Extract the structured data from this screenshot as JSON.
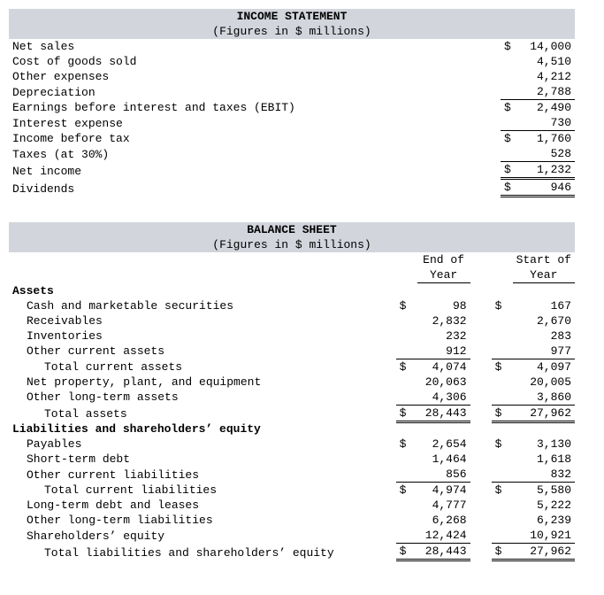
{
  "income": {
    "title": "INCOME STATEMENT",
    "subtitle": "(Figures in $ millions)",
    "rows": [
      {
        "label": "Net sales",
        "cur": "$",
        "val": "14,000",
        "indent": 0,
        "top": false,
        "dbl": false
      },
      {
        "label": "Cost of goods sold",
        "cur": "",
        "val": "4,510",
        "indent": 0,
        "top": false,
        "dbl": false
      },
      {
        "label": "Other expenses",
        "cur": "",
        "val": "4,212",
        "indent": 0,
        "top": false,
        "dbl": false
      },
      {
        "label": "Depreciation",
        "cur": "",
        "val": "2,788",
        "indent": 0,
        "top": false,
        "dbl": false
      },
      {
        "label": "Earnings before interest and taxes (EBIT)",
        "cur": "$",
        "val": "2,490",
        "indent": 0,
        "top": true,
        "dbl": false
      },
      {
        "label": "Interest expense",
        "cur": "",
        "val": "730",
        "indent": 0,
        "top": false,
        "dbl": false
      },
      {
        "label": "Income before tax",
        "cur": "$",
        "val": "1,760",
        "indent": 0,
        "top": true,
        "dbl": false
      },
      {
        "label": "Taxes (at 30%)",
        "cur": "",
        "val": "528",
        "indent": 0,
        "top": false,
        "dbl": false
      },
      {
        "label": "Net income",
        "cur": "$",
        "val": "1,232",
        "indent": 0,
        "top": true,
        "dbl": true
      },
      {
        "label": "Dividends",
        "cur": "$",
        "val": "946",
        "indent": 0,
        "top": false,
        "dbl": true
      }
    ]
  },
  "balance": {
    "title": "BALANCE SHEET",
    "subtitle": "(Figures in $ millions)",
    "col1_a": "End of",
    "col1_b": "Year",
    "col2_a": "Start of",
    "col2_b": "Year",
    "rows": [
      {
        "label": "Assets",
        "bold": true,
        "indent": 0,
        "cur1": "",
        "val1": "",
        "cur2": "",
        "val2": "",
        "top": false,
        "dbl": false
      },
      {
        "label": "Cash and marketable securities",
        "indent": 1,
        "cur1": "$",
        "val1": "98",
        "cur2": "$",
        "val2": "167",
        "top": false,
        "dbl": false
      },
      {
        "label": "Receivables",
        "indent": 1,
        "cur1": "",
        "val1": "2,832",
        "cur2": "",
        "val2": "2,670",
        "top": false,
        "dbl": false
      },
      {
        "label": "Inventories",
        "indent": 1,
        "cur1": "",
        "val1": "232",
        "cur2": "",
        "val2": "283",
        "top": false,
        "dbl": false
      },
      {
        "label": "Other current assets",
        "indent": 1,
        "cur1": "",
        "val1": "912",
        "cur2": "",
        "val2": "977",
        "top": false,
        "dbl": false
      },
      {
        "label": "Total current assets",
        "indent": 2,
        "cur1": "$",
        "val1": "4,074",
        "cur2": "$",
        "val2": "4,097",
        "top": true,
        "dbl": false
      },
      {
        "label": "Net property, plant, and equipment",
        "indent": 1,
        "cur1": "",
        "val1": "20,063",
        "cur2": "",
        "val2": "20,005",
        "top": false,
        "dbl": false
      },
      {
        "label": "Other long-term assets",
        "indent": 1,
        "cur1": "",
        "val1": "4,306",
        "cur2": "",
        "val2": "3,860",
        "top": false,
        "dbl": false
      },
      {
        "label": "Total assets",
        "indent": 2,
        "cur1": "$",
        "val1": "28,443",
        "cur2": "$",
        "val2": "27,962",
        "top": true,
        "dbl": true
      },
      {
        "label": "Liabilities and shareholders’ equity",
        "bold": true,
        "indent": 0,
        "cur1": "",
        "val1": "",
        "cur2": "",
        "val2": "",
        "top": false,
        "dbl": false
      },
      {
        "label": "Payables",
        "indent": 1,
        "cur1": "$",
        "val1": "2,654",
        "cur2": "$",
        "val2": "3,130",
        "top": false,
        "dbl": false
      },
      {
        "label": "Short-term debt",
        "indent": 1,
        "cur1": "",
        "val1": "1,464",
        "cur2": "",
        "val2": "1,618",
        "top": false,
        "dbl": false
      },
      {
        "label": "Other current liabilities",
        "indent": 1,
        "cur1": "",
        "val1": "856",
        "cur2": "",
        "val2": "832",
        "top": false,
        "dbl": false
      },
      {
        "label": "Total current liabilities",
        "indent": 2,
        "cur1": "$",
        "val1": "4,974",
        "cur2": "$",
        "val2": "5,580",
        "top": true,
        "dbl": false
      },
      {
        "label": "Long-term debt and leases",
        "indent": 1,
        "cur1": "",
        "val1": "4,777",
        "cur2": "",
        "val2": "5,222",
        "top": false,
        "dbl": false
      },
      {
        "label": "Other long-term liabilities",
        "indent": 1,
        "cur1": "",
        "val1": "6,268",
        "cur2": "",
        "val2": "6,239",
        "top": false,
        "dbl": false
      },
      {
        "label": "Shareholders’ equity",
        "indent": 1,
        "cur1": "",
        "val1": "12,424",
        "cur2": "",
        "val2": "10,921",
        "top": false,
        "dbl": false
      },
      {
        "label": "Total liabilities and shareholders’ equity",
        "indent": 2,
        "cur1": "$",
        "val1": "28,443",
        "cur2": "$",
        "val2": "27,962",
        "top": true,
        "dbl": true
      }
    ]
  }
}
